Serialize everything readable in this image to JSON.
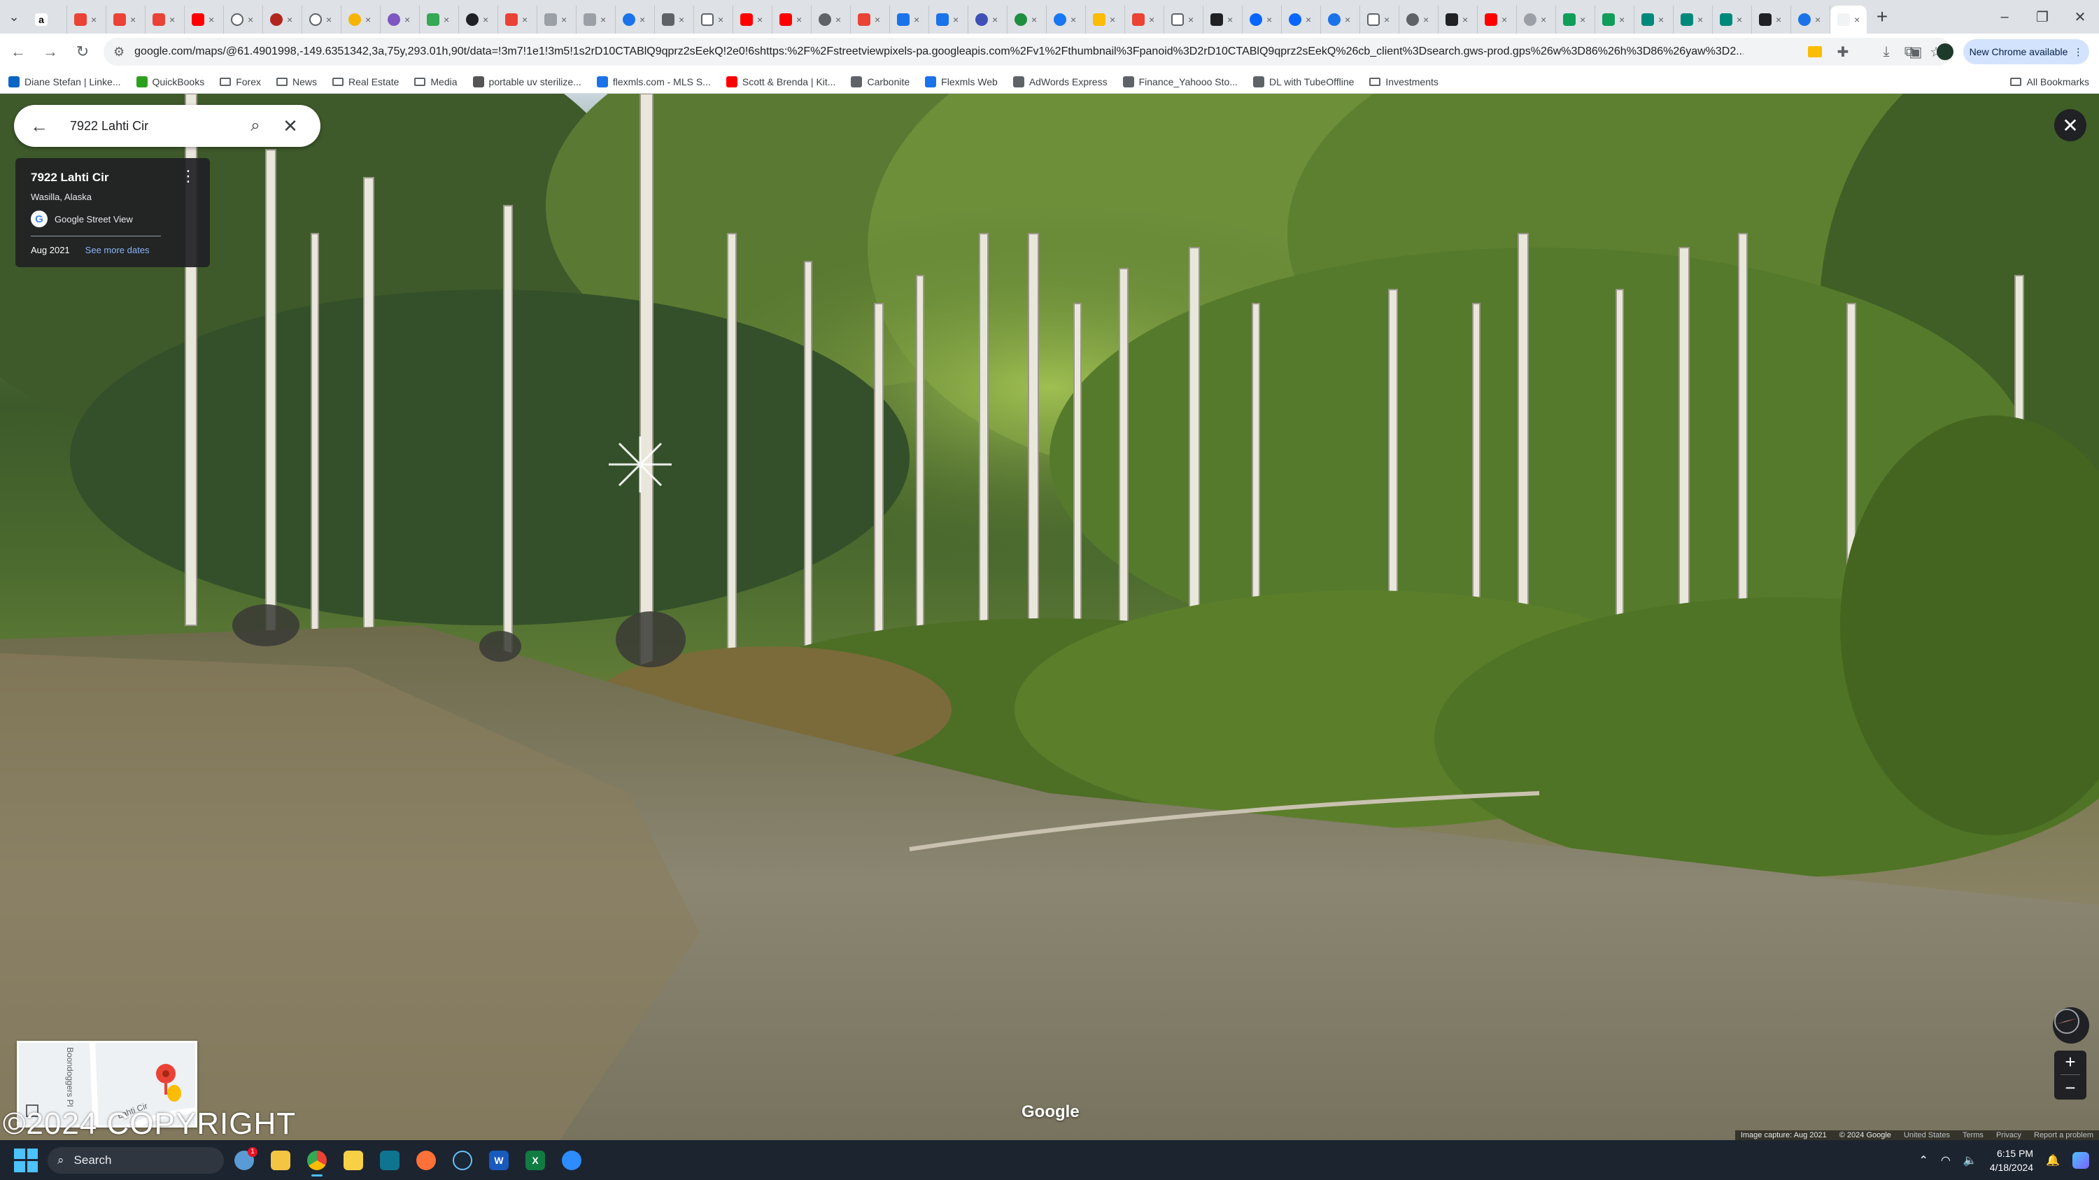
{
  "browser": {
    "tabs_count_hint": "many",
    "url": "google.com/maps/@61.4901998,-149.6351342,3a,75y,293.01h,90t/data=!3m7!1e1!3m5!1s2rD10CTABlQ9qprz2sEekQ!2e0!6shttps:%2F%2Fstreetviewpixels-pa.googleapis.com%2Fv1%2Fthumbnail%3Fpanoid%3D2rD10CTABlQ9qprz2sEekQ%26cb_client%3Dsearch.gws-prod.gps%26w%3D86%26h%3D86%26yaw%3D2...",
    "update_label": "New Chrome available",
    "bookmarks": [
      {
        "label": "Diane Stefan | Linke...",
        "kind": "site",
        "color": "#0a66c2"
      },
      {
        "label": "QuickBooks",
        "kind": "site",
        "color": "#2ca01c"
      },
      {
        "label": "Forex",
        "kind": "folder"
      },
      {
        "label": "News",
        "kind": "folder"
      },
      {
        "label": "Real Estate",
        "kind": "folder"
      },
      {
        "label": "Media",
        "kind": "folder"
      },
      {
        "label": "portable uv sterilize...",
        "kind": "site",
        "color": "#555555"
      },
      {
        "label": "flexmls.com - MLS S...",
        "kind": "site",
        "color": "#1a73e8"
      },
      {
        "label": "Scott & Brenda | Kit...",
        "kind": "site",
        "color": "#ff0000"
      },
      {
        "label": "Carbonite",
        "kind": "site",
        "color": "#5f6368"
      },
      {
        "label": "Flexmls Web",
        "kind": "site",
        "color": "#1a73e8"
      },
      {
        "label": "AdWords Express",
        "kind": "site",
        "color": "#5f6368"
      },
      {
        "label": "Finance_Yahooo Sto...",
        "kind": "site",
        "color": "#5f6368"
      },
      {
        "label": "DL with TubeOffline",
        "kind": "site",
        "color": "#5f6368"
      },
      {
        "label": "Investments",
        "kind": "folder"
      }
    ],
    "all_bookmarks_label": "All Bookmarks"
  },
  "maps": {
    "search_query": "7922 Lahti Cir",
    "card": {
      "title": "7922 Lahti Cir",
      "subtitle": "Wasilla, Alaska",
      "source": "Google Street View",
      "date": "Aug 2021",
      "more_dates": "See more dates"
    },
    "minimap_labels": [
      "Boondoggers Pl",
      "Lahti Cir"
    ],
    "overlay_text": "©2024 COPYRIGHT",
    "logo": "Google",
    "footer": {
      "capture": "Image capture: Aug 2021",
      "copyright": "© 2024 Google",
      "country": "United States",
      "terms": "Terms",
      "privacy": "Privacy",
      "report": "Report a problem"
    }
  },
  "taskbar": {
    "search_placeholder": "Search",
    "time": "6:15 PM",
    "date": "4/18/2024",
    "notification_badge": "1"
  }
}
